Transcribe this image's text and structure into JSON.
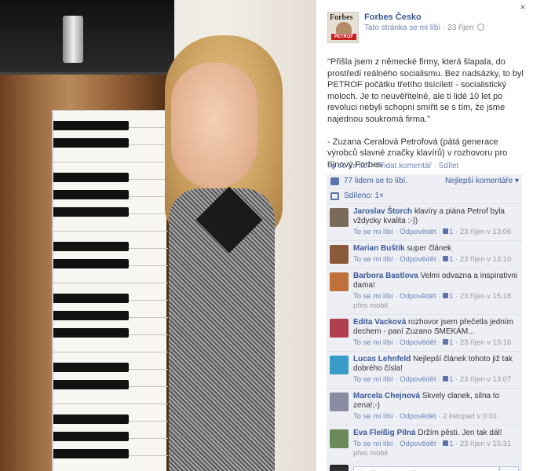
{
  "page": {
    "name": "Forbes Česko",
    "like_link": "Tato stránka se mi líbí",
    "date": "23 říjen",
    "avatar_title": "Forbes",
    "avatar_band": "PETROF"
  },
  "post": {
    "text": "\"Přišla jsem z německé firmy, která šlapala, do prostředí reálného socialismu. Bez nadsázky, to byl PETROF počátku třetího tisíciletí - socialistický moloch. Je to neuvěřitelné, ale ti lidé 10 let po revoluci nebyli schopni smířit se s tím, že jsme najednou soukromá firma.\"\n\n- Zuzana Ceralová Petrofová (pátá generace výrobců slavné značky klavírů) v rozhovoru pro říjnový Forbes",
    "actions": {
      "like": "To se mi líbí",
      "comment": "Přidat komentář",
      "share": "Sdílet"
    }
  },
  "ufi": {
    "likes": "77 lidem se to líbí.",
    "sort": "Nejlepší komentáře ▾",
    "shares": "Sdíleno: 1×"
  },
  "comments": [
    {
      "author": "Jaroslav Štorch",
      "text": "klavíry a piána Petrof byla vždycky kvalita :-))",
      "like": "To se mi líbí",
      "reply": "Odpovědět",
      "likes": "1",
      "time": "23 říjen v 13:06",
      "avatar_color": "#7a6a5a"
    },
    {
      "author": "Marian Buštík",
      "text": "super článek",
      "like": "To se mi líbí",
      "reply": "Odpovědět",
      "likes": "1",
      "time": "23 říjen v 13:10",
      "avatar_color": "#8a5a3a"
    },
    {
      "author": "Barbora Bastlova",
      "text": "Velmi odvazna a inspirativni dama!",
      "like": "To se mi líbí",
      "reply": "Odpovědět",
      "likes": "1",
      "time": "23 říjen v 15:18 přes mobil",
      "avatar_color": "#c0703a"
    },
    {
      "author": "Edita Vacková",
      "text": "rozhovor jsem přečetla jedním dechem - paní Zuzano SMEKÁM...",
      "like": "To se mi líbí",
      "reply": "Odpovědět",
      "likes": "1",
      "time": "23 říjen v 13:16",
      "avatar_color": "#b04050"
    },
    {
      "author": "Lucas Lehnfeld",
      "text": "Nejlepší článek tohoto již tak dobrého čísla!",
      "like": "To se mi líbí",
      "reply": "Odpovědět",
      "likes": "1",
      "time": "23 říjen v 13:07",
      "avatar_color": "#3a9ac8"
    },
    {
      "author": "Marcela Chejnová",
      "text": "Skvely clanek, silna to zena!;-)",
      "like": "To se mi líbí",
      "reply": "Odpovědět",
      "likes": "",
      "time": "2 listopad v 0:01",
      "avatar_color": "#8a8aa0"
    },
    {
      "author": "Eva Fleißig Pilná",
      "text": "Držím pěsti. Jen tak dál!",
      "like": "To se mi líbí",
      "reply": "Odpovědět",
      "likes": "1",
      "time": "23 říjen v 15:31 přes mobil",
      "avatar_color": "#6a8a5a"
    }
  ],
  "composer": {
    "placeholder": "Napište komentář..."
  },
  "close": "×"
}
